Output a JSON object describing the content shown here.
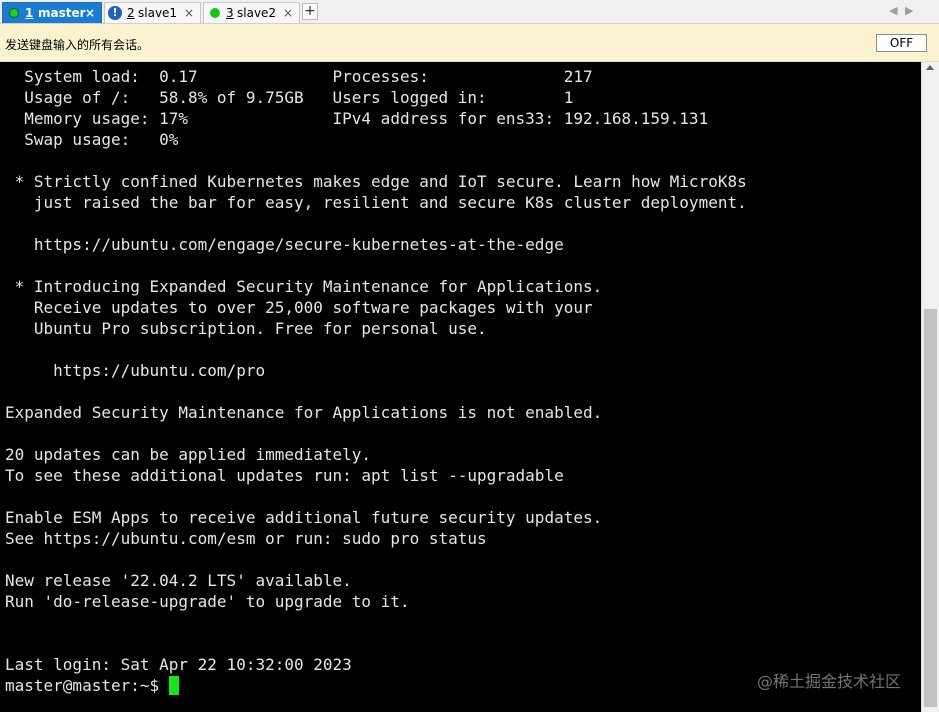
{
  "tabs": [
    {
      "number": "1",
      "name": "master",
      "active": true,
      "status": "connected"
    },
    {
      "number": "2",
      "name": "slave1",
      "active": false,
      "status": "warning"
    },
    {
      "number": "3",
      "name": "slave2",
      "active": false,
      "status": "connected"
    }
  ],
  "tab_controls": {
    "close_glyph": "×",
    "new_tab_glyph": "+",
    "scroll_left_glyph": "◀",
    "scroll_right_glyph": "▶",
    "warning_glyph": "!"
  },
  "notification": {
    "text": "发送键盘输入的所有会话。",
    "toggle_label": "OFF"
  },
  "terminal": {
    "lines": [
      "  System load:  0.17              Processes:              217",
      "  Usage of /:   58.8% of 9.75GB   Users logged in:        1",
      "  Memory usage: 17%               IPv4 address for ens33: 192.168.159.131",
      "  Swap usage:   0%",
      "",
      " * Strictly confined Kubernetes makes edge and IoT secure. Learn how MicroK8s",
      "   just raised the bar for easy, resilient and secure K8s cluster deployment.",
      "",
      "   https://ubuntu.com/engage/secure-kubernetes-at-the-edge",
      "",
      " * Introducing Expanded Security Maintenance for Applications.",
      "   Receive updates to over 25,000 software packages with your",
      "   Ubuntu Pro subscription. Free for personal use.",
      "",
      "     https://ubuntu.com/pro",
      "",
      "Expanded Security Maintenance for Applications is not enabled.",
      "",
      "20 updates can be applied immediately.",
      "To see these additional updates run: apt list --upgradable",
      "",
      "Enable ESM Apps to receive additional future security updates.",
      "See https://ubuntu.com/esm or run: sudo pro status",
      "",
      "New release '22.04.2 LTS' available.",
      "Run 'do-release-upgrade' to upgrade to it.",
      "",
      "",
      "Last login: Sat Apr 22 10:32:00 2023"
    ],
    "prompt": "master@master:~$"
  },
  "watermark": "@稀土掘金技术社区",
  "colors": {
    "terminal_bg": "#000000",
    "terminal_fg": "#e6e6e6",
    "cursor": "#17e617",
    "active_tab": "#1a7dd4",
    "status_connected": "#19c219",
    "status_warning": "#1d60c8",
    "notice_bg": "#fbf3cf"
  }
}
